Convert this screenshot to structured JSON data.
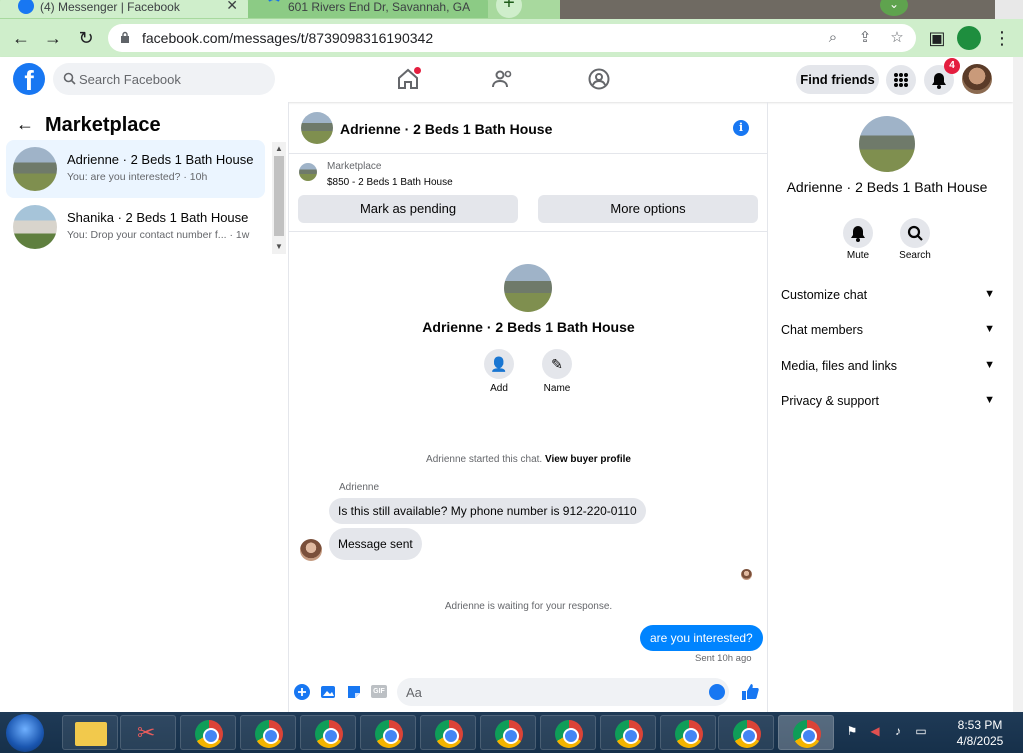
{
  "browser": {
    "tabs": [
      {
        "title": "(4) Messenger | Facebook",
        "active": true
      },
      {
        "title": "601 Rivers End Dr, Savannah, GA",
        "active": false
      }
    ],
    "url": "facebook.com/messages/t/8739098316190342",
    "new_tab_label": "+",
    "tab_close": "✕"
  },
  "fb_header": {
    "logo": "f",
    "search_placeholder": "Search Facebook",
    "find_friends": "Find friends",
    "notification_count": "4"
  },
  "left_panel": {
    "title": "Marketplace",
    "conversations": [
      {
        "name": "Adrienne · 2 Beds 1 Bath House",
        "preview": "You: are you interested? · 10h",
        "active": true
      },
      {
        "name": "Shanika · 2 Beds 1 Bath House",
        "preview": "You: Drop your contact number f... · 1w",
        "active": false
      }
    ]
  },
  "chat": {
    "title": "Adrienne · 2 Beds 1 Bath House",
    "marketplace_label": "Marketplace",
    "listing": "$850 - 2 Beds 1 Bath House",
    "mark_pending": "Mark as pending",
    "more_options": "More options",
    "intro_title": "Adrienne · 2 Beds 1 Bath House",
    "actions": [
      {
        "label": "Add"
      },
      {
        "label": "Name"
      }
    ],
    "started_text": "Adrienne started this chat.",
    "view_profile": "View buyer profile",
    "sender_name": "Adrienne",
    "messages_in": [
      "Is this still available? My phone number is 912-220-0110",
      "Message sent"
    ],
    "waiting_text": "Adrienne is waiting for your response.",
    "message_out": "are you interested?",
    "sent_status": "Sent 10h ago",
    "compose_placeholder": "Aa",
    "gif_label": "GIF"
  },
  "right_panel": {
    "title": "Adrienne · 2 Beds 1 Bath House",
    "mute": "Mute",
    "search": "Search",
    "sections": [
      "Customize chat",
      "Chat members",
      "Media, files and links",
      "Privacy & support"
    ]
  },
  "taskbar": {
    "time": "8:53 PM",
    "date": "4/8/2025"
  },
  "colors": {
    "fb_blue": "#1877f2",
    "messenger_blue": "#0084ff",
    "chrome_green": "#cfeecb"
  }
}
